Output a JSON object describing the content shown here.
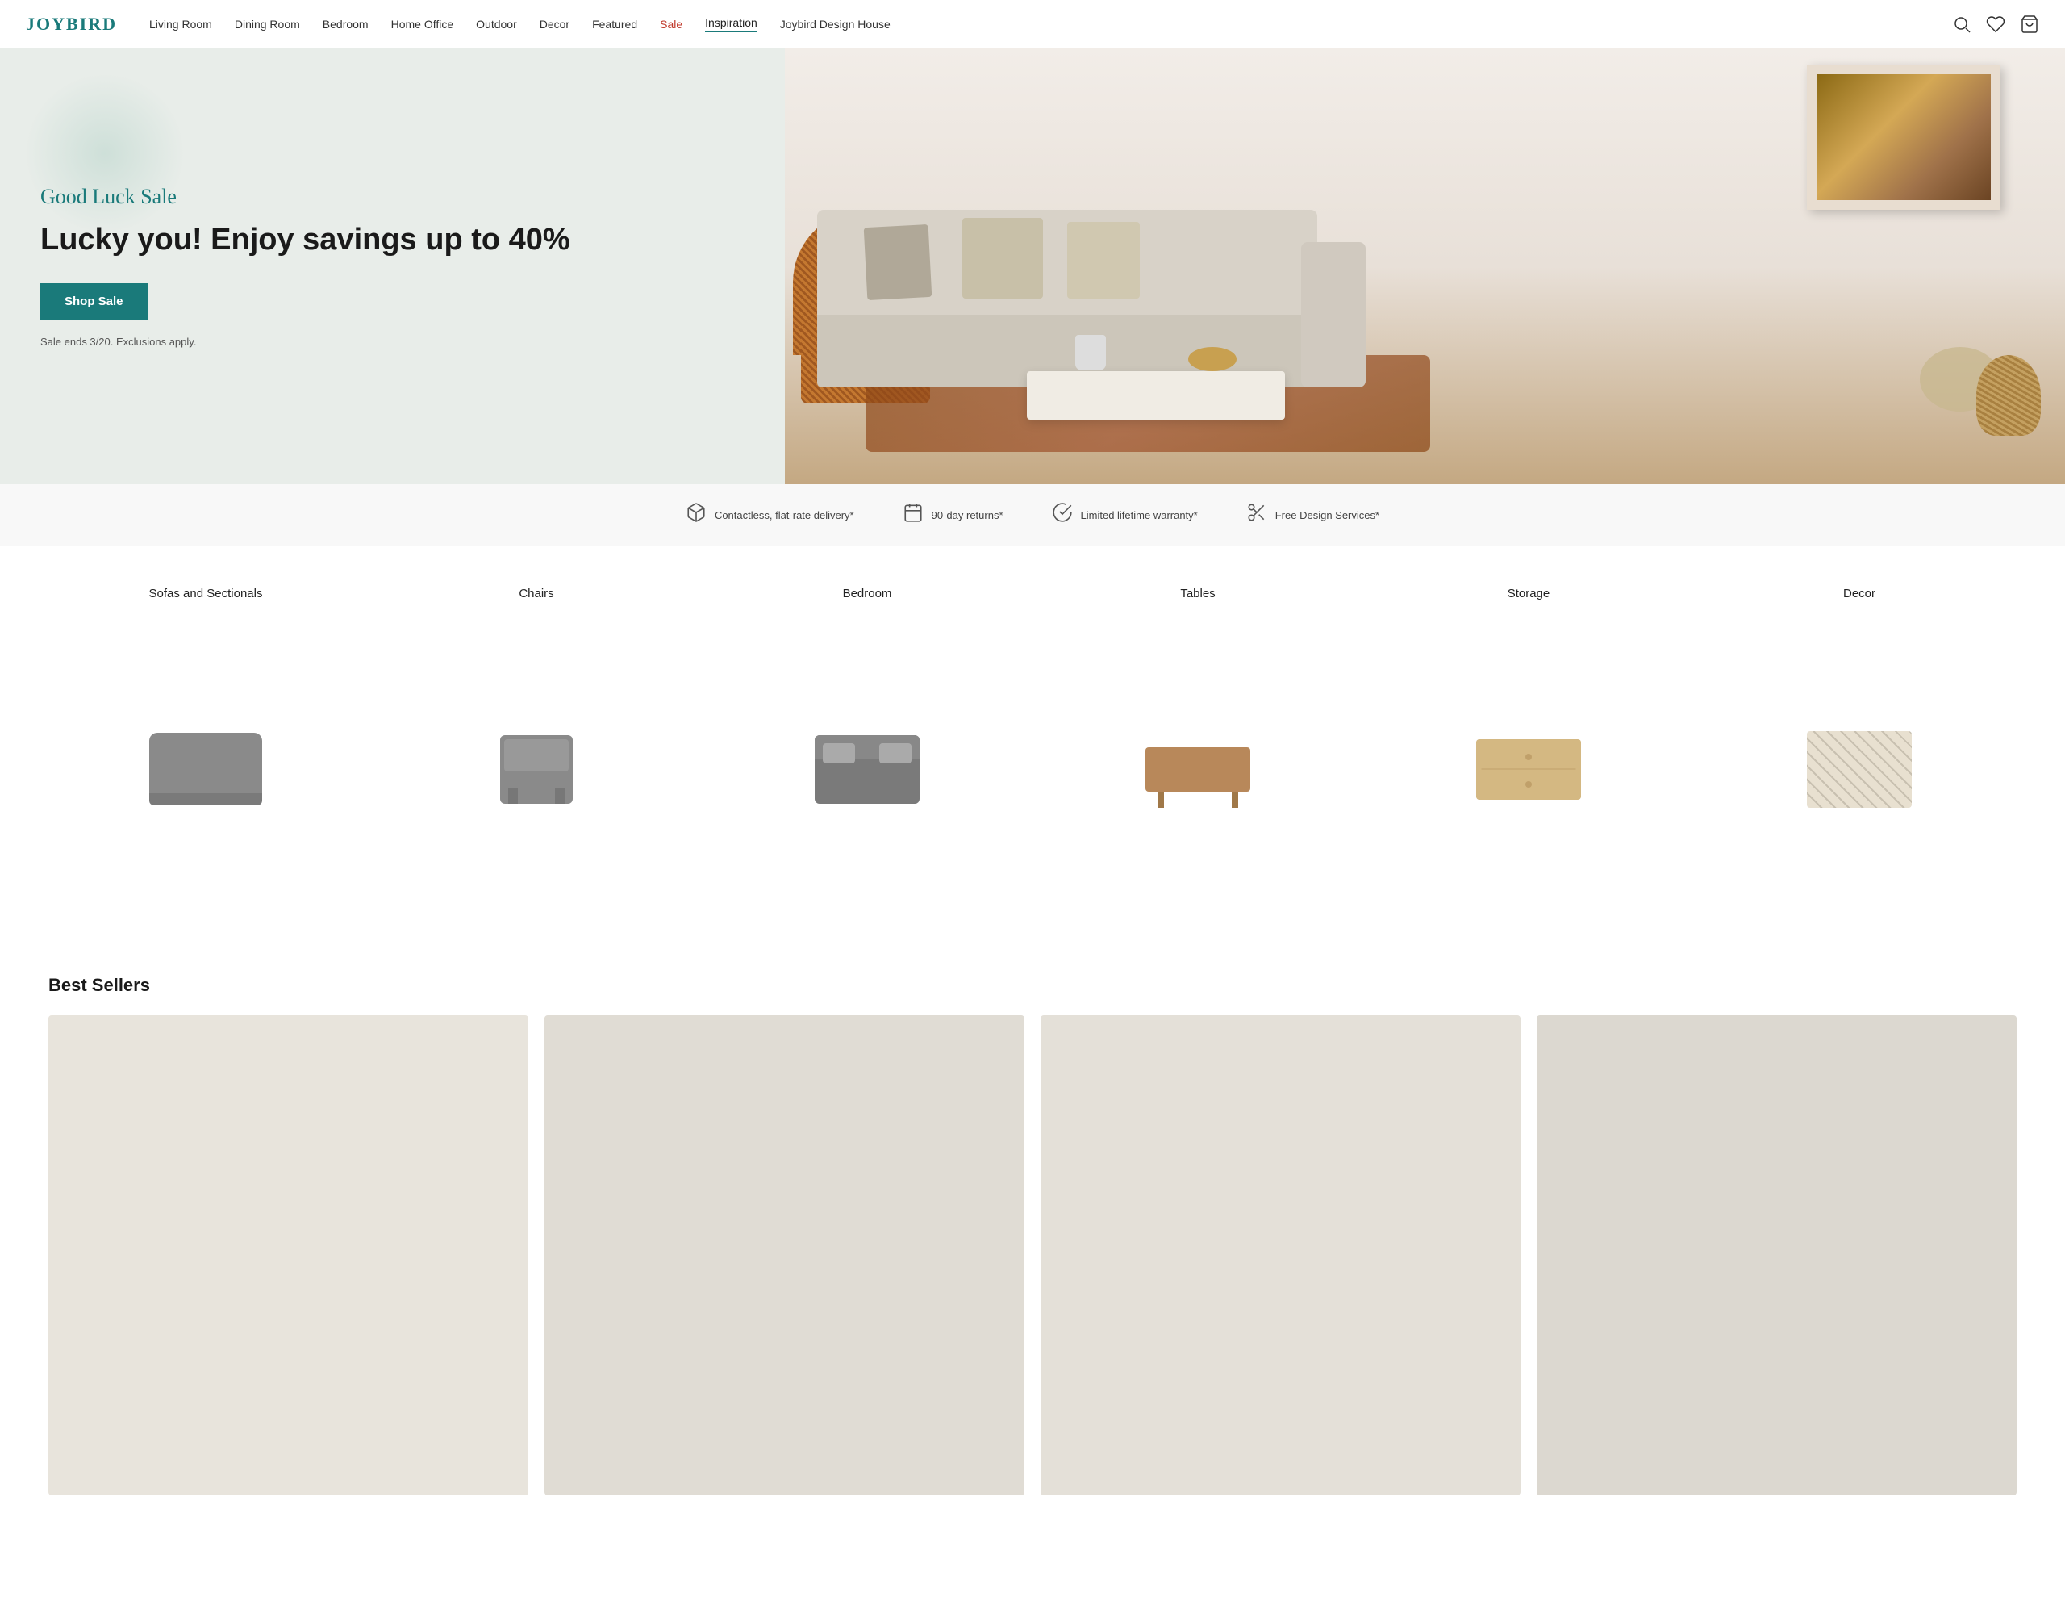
{
  "header": {
    "logo": "JOYBIRD",
    "nav": [
      {
        "label": "Living Room",
        "id": "living-room",
        "active": false,
        "sale": false
      },
      {
        "label": "Dining Room",
        "id": "dining-room",
        "active": false,
        "sale": false
      },
      {
        "label": "Bedroom",
        "id": "bedroom",
        "active": false,
        "sale": false
      },
      {
        "label": "Home Office",
        "id": "home-office",
        "active": false,
        "sale": false
      },
      {
        "label": "Outdoor",
        "id": "outdoor",
        "active": false,
        "sale": false
      },
      {
        "label": "Decor",
        "id": "decor",
        "active": false,
        "sale": false
      },
      {
        "label": "Featured",
        "id": "featured",
        "active": false,
        "sale": false
      },
      {
        "label": "Sale",
        "id": "sale",
        "active": false,
        "sale": true
      },
      {
        "label": "Inspiration",
        "id": "inspiration",
        "active": true,
        "sale": false
      },
      {
        "label": "Joybird Design House",
        "id": "design-house",
        "active": false,
        "sale": false
      }
    ]
  },
  "hero": {
    "eyebrow": "Good Luck Sale",
    "headline": "Lucky you! Enjoy savings up to 40%",
    "cta_label": "Shop Sale",
    "disclaimer": "Sale ends 3/20. Exclusions apply."
  },
  "features": [
    {
      "icon": "box-icon",
      "text": "Contactless, flat-rate delivery*"
    },
    {
      "icon": "calendar-icon",
      "text": "90-day returns*"
    },
    {
      "icon": "check-circle-icon",
      "text": "Limited lifetime warranty*"
    },
    {
      "icon": "scissors-icon",
      "text": "Free Design Services*"
    }
  ],
  "categories": [
    {
      "label": "Sofas and Sectionals",
      "id": "sofas"
    },
    {
      "label": "Chairs",
      "id": "chairs"
    },
    {
      "label": "Bedroom",
      "id": "bedroom-cat"
    },
    {
      "label": "Tables",
      "id": "tables"
    },
    {
      "label": "Storage",
      "id": "storage"
    },
    {
      "label": "Decor",
      "id": "decor-cat"
    }
  ],
  "best_sellers": {
    "title": "Best Sellers"
  },
  "colors": {
    "brand_teal": "#1a7a7a",
    "sale_red": "#c0392b",
    "hero_bg": "#e8ede9",
    "cta_bg": "#1a7a7a",
    "feature_bar_bg": "#f8f8f8"
  }
}
